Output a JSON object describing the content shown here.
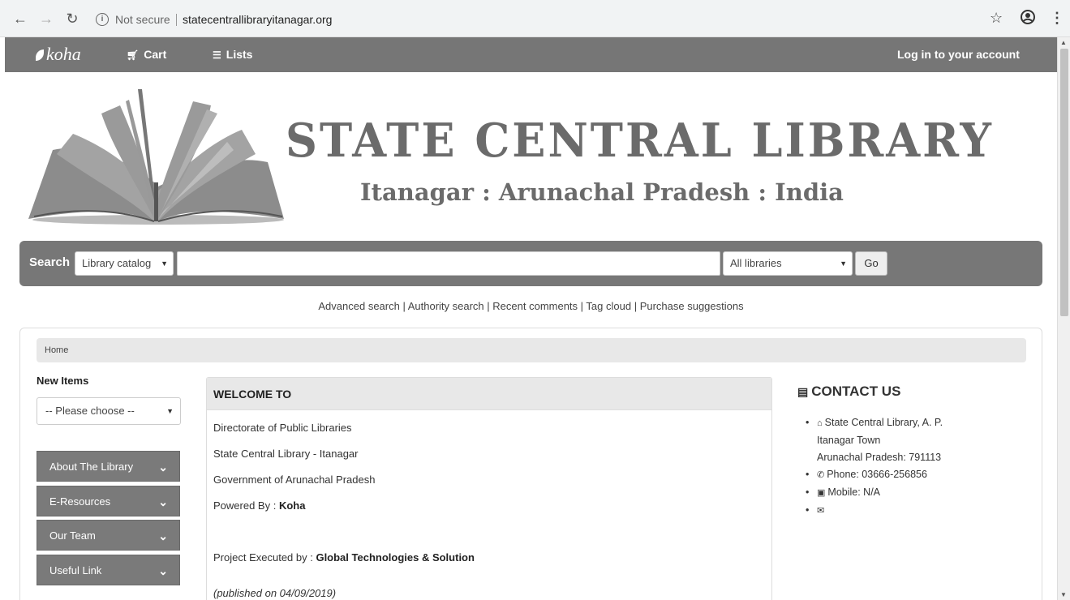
{
  "browser": {
    "security": "Not secure",
    "url": "statecentrallibraryitanagar.org"
  },
  "navbar": {
    "logo": "koha",
    "cart": "Cart",
    "lists": "Lists",
    "login": "Log in to your account"
  },
  "banner": {
    "title": "STATE CENTRAL LIBRARY",
    "subtitle": "Itanagar : Arunachal Pradesh : India"
  },
  "search": {
    "label": "Search",
    "scope": "Library catalog",
    "branch": "All libraries",
    "go": "Go"
  },
  "more_searches": {
    "advanced": "Advanced search",
    "authority": "Authority search",
    "comments": "Recent comments",
    "tagcloud": "Tag cloud",
    "suggestions": "Purchase suggestions"
  },
  "breadcrumb": "Home",
  "new_items": {
    "label": "New Items",
    "selected": "-- Please choose --"
  },
  "sidebar": {
    "items": [
      {
        "label": "About The Library"
      },
      {
        "label": "E-Resources"
      },
      {
        "label": "Our Team"
      },
      {
        "label": "Useful Link"
      }
    ]
  },
  "welcome": {
    "heading": "WELCOME TO",
    "line1": "Directorate of Public Libraries",
    "line2": "State Central Library - Itanagar",
    "line3": "Government of Arunachal Pradesh",
    "powered_label": "Powered By : ",
    "powered_value": "Koha",
    "project_label": "Project Executed by : ",
    "project_value": "Global Technologies & Solution",
    "published": "(published on 04/09/2019)"
  },
  "contact": {
    "title": "CONTACT US",
    "address_line1": "State Central Library, A. P.",
    "address_line2": "Itanagar Town",
    "address_line3": "Arunachal Pradesh: 791113",
    "phone": "Phone: 03666-256856",
    "mobile": "Mobile: N/A"
  }
}
